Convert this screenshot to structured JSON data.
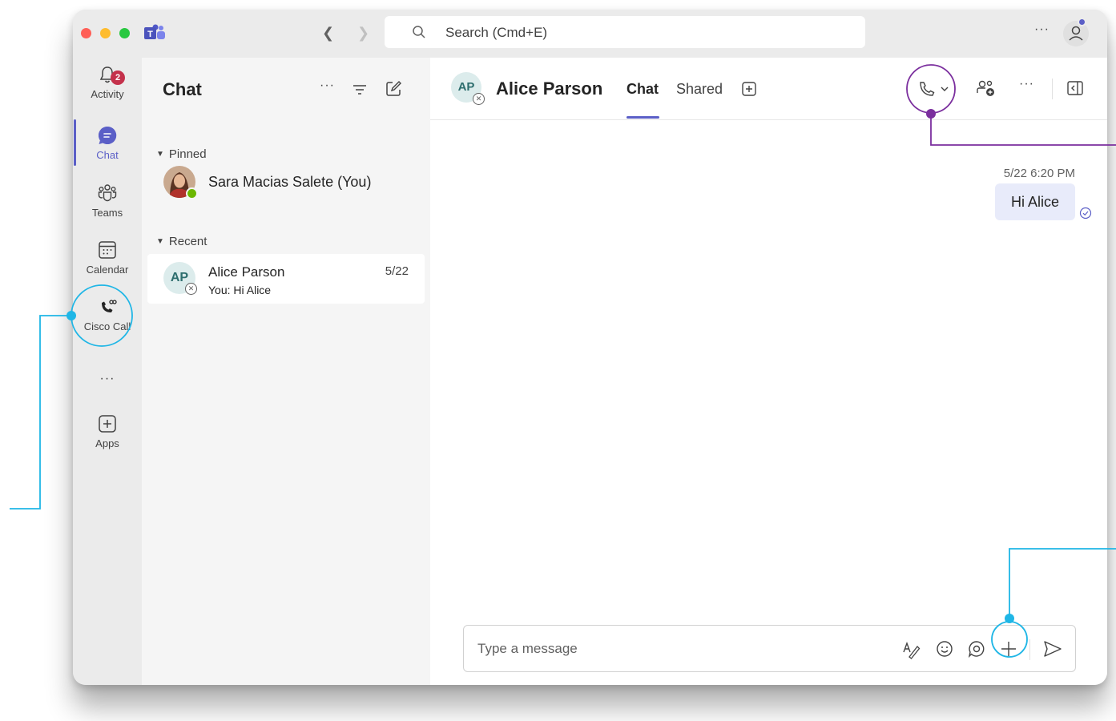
{
  "titlebar": {
    "search_placeholder": "Search (Cmd+E)",
    "more_label": "···"
  },
  "rail": {
    "items": [
      {
        "label": "Activity",
        "badge": "2"
      },
      {
        "label": "Chat"
      },
      {
        "label": "Teams"
      },
      {
        "label": "Calendar"
      },
      {
        "label": "Cisco Call"
      },
      {
        "label": "Apps"
      }
    ],
    "more_label": "···"
  },
  "list": {
    "title": "Chat",
    "more_label": "···",
    "pinned_header": "Pinned",
    "recent_header": "Recent",
    "pinned": [
      {
        "name": "Sara Macias Salete (You)"
      }
    ],
    "recent": [
      {
        "initials": "AP",
        "name": "Alice Parson",
        "preview": "You: Hi Alice",
        "date": "5/22"
      }
    ]
  },
  "chat": {
    "initials": "AP",
    "name": "Alice Parson",
    "tabs": [
      "Chat",
      "Shared"
    ],
    "more_label": "···",
    "messages": [
      {
        "time": "5/22 6:20 PM",
        "text": "Hi Alice"
      }
    ],
    "compose_placeholder": "Type a message"
  },
  "colors": {
    "accent": "#5b5fc7",
    "callout_cyan": "#1fb6e6",
    "callout_purple": "#7b2f9e",
    "badge": "#c4314b"
  }
}
